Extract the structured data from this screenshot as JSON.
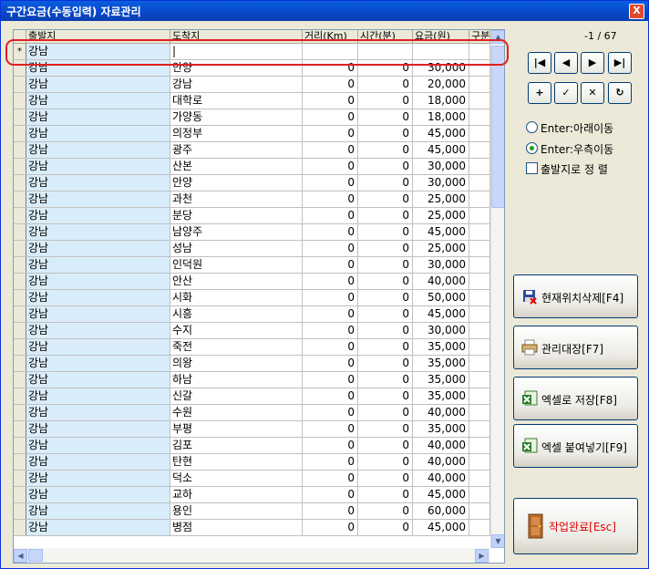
{
  "window": {
    "title": "구간요금(수동입력) 자료관리",
    "close": "X"
  },
  "columns": [
    "출발지",
    "도착지",
    "거리(Km)",
    "시간(분)",
    "요금(원)",
    "구분"
  ],
  "new_row": {
    "marker": "*",
    "departure": "강남",
    "destination": "|"
  },
  "rows": [
    {
      "departure": "강남",
      "destination": "안양",
      "distance": "0",
      "time": "0",
      "fare": "30,000"
    },
    {
      "departure": "강남",
      "destination": "강남",
      "distance": "0",
      "time": "0",
      "fare": "20,000"
    },
    {
      "departure": "강남",
      "destination": "대학로",
      "distance": "0",
      "time": "0",
      "fare": "18,000"
    },
    {
      "departure": "강남",
      "destination": "가양동",
      "distance": "0",
      "time": "0",
      "fare": "18,000"
    },
    {
      "departure": "강남",
      "destination": "의정부",
      "distance": "0",
      "time": "0",
      "fare": "45,000"
    },
    {
      "departure": "강남",
      "destination": "광주",
      "distance": "0",
      "time": "0",
      "fare": "45,000"
    },
    {
      "departure": "강남",
      "destination": "산본",
      "distance": "0",
      "time": "0",
      "fare": "30,000"
    },
    {
      "departure": "강남",
      "destination": "안양",
      "distance": "0",
      "time": "0",
      "fare": "30,000"
    },
    {
      "departure": "강남",
      "destination": "과천",
      "distance": "0",
      "time": "0",
      "fare": "25,000"
    },
    {
      "departure": "강남",
      "destination": "분당",
      "distance": "0",
      "time": "0",
      "fare": "25,000"
    },
    {
      "departure": "강남",
      "destination": "남양주",
      "distance": "0",
      "time": "0",
      "fare": "45,000"
    },
    {
      "departure": "강남",
      "destination": "성남",
      "distance": "0",
      "time": "0",
      "fare": "25,000"
    },
    {
      "departure": "강남",
      "destination": "인덕원",
      "distance": "0",
      "time": "0",
      "fare": "30,000"
    },
    {
      "departure": "강남",
      "destination": "안산",
      "distance": "0",
      "time": "0",
      "fare": "40,000"
    },
    {
      "departure": "강남",
      "destination": "시화",
      "distance": "0",
      "time": "0",
      "fare": "50,000"
    },
    {
      "departure": "강남",
      "destination": "시흥",
      "distance": "0",
      "time": "0",
      "fare": "45,000"
    },
    {
      "departure": "강남",
      "destination": "수지",
      "distance": "0",
      "time": "0",
      "fare": "30,000"
    },
    {
      "departure": "강남",
      "destination": "죽전",
      "distance": "0",
      "time": "0",
      "fare": "35,000"
    },
    {
      "departure": "강남",
      "destination": "의왕",
      "distance": "0",
      "time": "0",
      "fare": "35,000"
    },
    {
      "departure": "강남",
      "destination": "하남",
      "distance": "0",
      "time": "0",
      "fare": "35,000"
    },
    {
      "departure": "강남",
      "destination": "신갈",
      "distance": "0",
      "time": "0",
      "fare": "35,000"
    },
    {
      "departure": "강남",
      "destination": "수원",
      "distance": "0",
      "time": "0",
      "fare": "40,000"
    },
    {
      "departure": "강남",
      "destination": "부평",
      "distance": "0",
      "time": "0",
      "fare": "35,000"
    },
    {
      "departure": "강남",
      "destination": "김포",
      "distance": "0",
      "time": "0",
      "fare": "40,000"
    },
    {
      "departure": "강남",
      "destination": "탄현",
      "distance": "0",
      "time": "0",
      "fare": "40,000"
    },
    {
      "departure": "강남",
      "destination": "덕소",
      "distance": "0",
      "time": "0",
      "fare": "40,000"
    },
    {
      "departure": "강남",
      "destination": "교하",
      "distance": "0",
      "time": "0",
      "fare": "45,000"
    },
    {
      "departure": "강남",
      "destination": "용인",
      "distance": "0",
      "time": "0",
      "fare": "60,000"
    },
    {
      "departure": "강남",
      "destination": "병점",
      "distance": "0",
      "time": "0",
      "fare": "45,000"
    }
  ],
  "nav": {
    "counter": "-1 / 67",
    "first": "|◀",
    "prev": "◀",
    "next": "▶",
    "last": "▶|",
    "add": "+",
    "confirm": "✓",
    "cancel": "✕",
    "refresh": "↻"
  },
  "options": {
    "enter_down": "Enter:아래이동",
    "enter_right": "Enter:우측이동",
    "sort_by_departure": "출발지로 정 렬",
    "selected": "enter_right"
  },
  "buttons": {
    "delete_current": "현재위치삭제[F4]",
    "ledger": "관리대장[F7]",
    "excel_save": "엑셀로 저장[F8]",
    "excel_paste": "엑셀 붙여넣기[F9]",
    "finish": "작업완료[Esc]"
  },
  "colors": {
    "title_bar": "#0746c8",
    "departure_column": "#d9ecf9",
    "highlight": "#e02020",
    "finish_text": "#e00000"
  }
}
